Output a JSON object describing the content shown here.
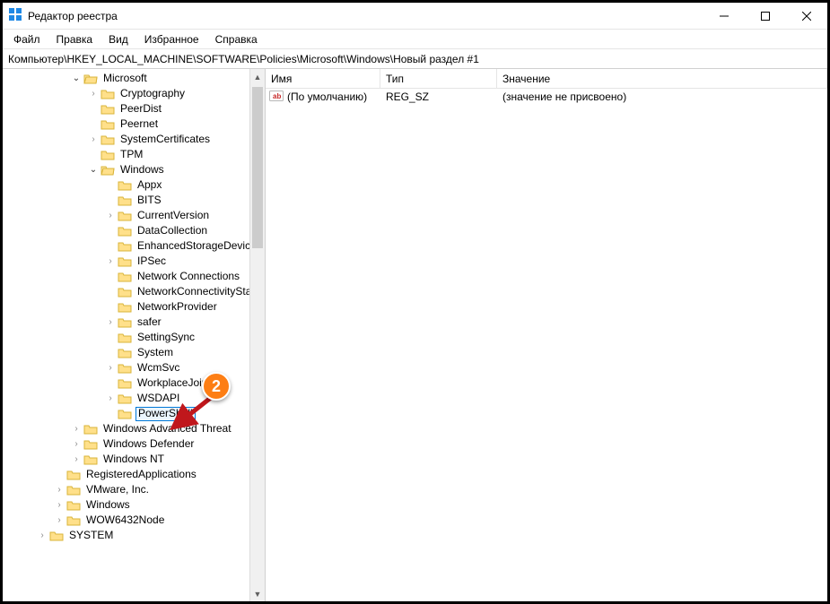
{
  "window": {
    "title": "Редактор реестра"
  },
  "menu": {
    "file": "Файл",
    "edit": "Правка",
    "view": "Вид",
    "favorites": "Избранное",
    "help": "Справка"
  },
  "address": "Компьютер\\HKEY_LOCAL_MACHINE\\SOFTWARE\\Policies\\Microsoft\\Windows\\Новый раздел #1",
  "columns": {
    "name": "Имя",
    "type": "Тип",
    "value": "Значение"
  },
  "details": {
    "default_name": "(По умолчанию)",
    "default_type": "REG_SZ",
    "default_value": "(значение не присвоено)"
  },
  "tree": {
    "microsoft": "Microsoft",
    "cryptography": "Cryptography",
    "peerdist": "PeerDist",
    "peernet": "Peernet",
    "system_certificates": "SystemCertificates",
    "tpm": "TPM",
    "windows": "Windows",
    "appx": "Appx",
    "bits": "BITS",
    "current_version": "CurrentVersion",
    "data_collection": "DataCollection",
    "enhanced_storage": "EnhancedStorageDevices",
    "ipsec": "IPSec",
    "network_connections": "Network Connections",
    "network_connectivity": "NetworkConnectivitySta",
    "network_provider": "NetworkProvider",
    "safer": "safer",
    "setting_sync": "SettingSync",
    "system": "System",
    "wcmsvc": "WcmSvc",
    "workplace_join": "WorkplaceJoin",
    "wsdapi": "WSDAPI",
    "powershell": "PowerShell",
    "windows_adv_threat": "Windows Advanced Threat",
    "windows_defender": "Windows Defender",
    "windows_nt": "Windows NT",
    "registered_apps": "RegisteredApplications",
    "vmware": "VMware, Inc.",
    "windows2": "Windows",
    "wow64": "WOW6432Node",
    "system2": "SYSTEM"
  },
  "annotation": {
    "badge": "2"
  }
}
